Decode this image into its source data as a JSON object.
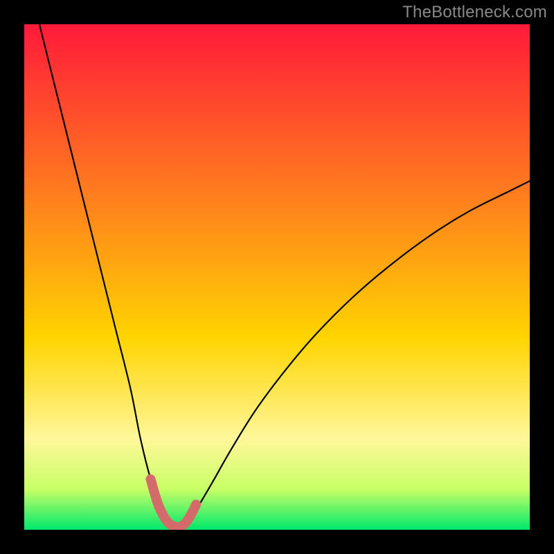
{
  "watermark": "TheBottleneck.com",
  "colors": {
    "page_bg": "#000000",
    "watermark_text": "#888888",
    "curve_stroke": "#000000",
    "marker_stroke": "#d46a6a",
    "gradient_stops": [
      {
        "offset": "0%",
        "color": "#ff1a3a"
      },
      {
        "offset": "38%",
        "color": "#ff8a1a"
      },
      {
        "offset": "62%",
        "color": "#ffd400"
      },
      {
        "offset": "82%",
        "color": "#fff79a"
      },
      {
        "offset": "92%",
        "color": "#c8ff66"
      },
      {
        "offset": "100%",
        "color": "#00e86b"
      }
    ]
  },
  "chart_data": {
    "type": "line",
    "title": "",
    "xlabel": "",
    "ylabel": "",
    "xlim": [
      0,
      100
    ],
    "ylim": [
      0,
      100
    ],
    "grid": false,
    "legend": false,
    "series": [
      {
        "name": "bottleneck-curve",
        "x": [
          3,
          6,
          9,
          12,
          15,
          18,
          21,
          23,
          25,
          27,
          28.5,
          30,
          32,
          34,
          37,
          41,
          46,
          52,
          58,
          65,
          72,
          80,
          88,
          96,
          100
        ],
        "y": [
          100,
          88,
          76,
          64,
          52,
          40,
          28,
          18,
          10,
          4,
          1.5,
          0.5,
          1.5,
          4,
          9,
          16,
          24,
          32,
          39,
          46,
          52,
          58,
          63,
          67,
          69
        ]
      }
    ],
    "marker_segment": {
      "name": "min-emphasis",
      "x": [
        25,
        26.5,
        28,
        29.5,
        31,
        32,
        33,
        34
      ],
      "y": [
        10,
        5,
        2,
        0.7,
        0.7,
        1.5,
        3,
        5
      ],
      "stroke_width": 14
    }
  }
}
